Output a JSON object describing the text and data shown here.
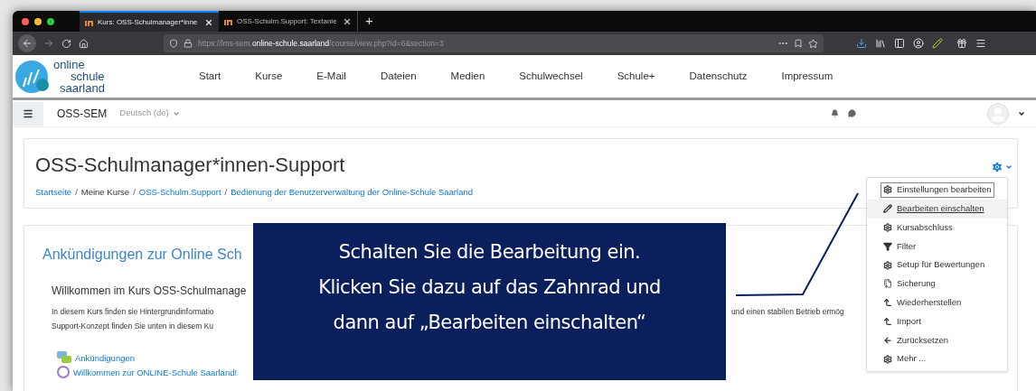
{
  "browser": {
    "tabs": [
      {
        "label": "Kurs: OSS-Schulmanager*inne",
        "selected": true
      },
      {
        "label": "OSS-Schulm.Support: Textanle",
        "selected": false
      }
    ],
    "new_tab": "+",
    "url": {
      "prefix": "https://lms-sem.",
      "domain": "online-schule.saarland",
      "path": "/course/view.php?id=6&section=3"
    }
  },
  "site": {
    "logo_lines": [
      "online",
      "schule",
      "saarland"
    ],
    "nav": [
      "Start",
      "Kurse",
      "E-Mail",
      "Dateien",
      "Medien",
      "Schulwechsel",
      "Schule+",
      "Datenschutz",
      "Impressum"
    ]
  },
  "topbar": {
    "site_name": "OSS-SEM",
    "language": "Deutsch (de)"
  },
  "course": {
    "title": "OSS-Schulmanager*innen-Support",
    "breadcrumb": [
      {
        "label": "Startseite",
        "link": true
      },
      {
        "separator": "/",
        "label": "Meine Kurse",
        "link": false
      },
      {
        "separator": "/",
        "label": "OSS-Schulm.Support",
        "link": true
      },
      {
        "separator": "/",
        "label": "Bedienung der Benutzerverwaltung der Online-Schule Saarland",
        "link": true
      }
    ]
  },
  "section": {
    "heading": "Ankündigungen zur Online Sch",
    "welcome": "Willkommen im Kurs OSS-Schulmanage",
    "paragraph_lines": [
      "In diesem Kurs finden sie Hintergrundinformatio",
      "Support-Konzept finden Sie unten in diesem Ku"
    ],
    "paragraph_right": "und einen stabilen Betrieb ermög",
    "activities": [
      {
        "label": "Ankündigungen",
        "kind": "forum"
      },
      {
        "label": "Willkommen zur ONLINE-Schule Saarland!",
        "kind": "page"
      }
    ]
  },
  "menu": {
    "items": [
      {
        "label": "Einstellungen bearbeiten",
        "kind": "gear",
        "focused": true,
        "hovered": false
      },
      {
        "label": "Bearbeiten einschalten",
        "kind": "pencil",
        "focused": false,
        "hovered": true
      },
      {
        "label": "Kursabschluss",
        "kind": "gear",
        "focused": false,
        "hovered": false
      },
      {
        "label": "Filter",
        "kind": "filter",
        "focused": false,
        "hovered": false
      },
      {
        "label": "Setup für Bewertungen",
        "kind": "gear",
        "focused": false,
        "hovered": false
      },
      {
        "label": "Sicherung",
        "kind": "file",
        "focused": false,
        "hovered": false
      },
      {
        "label": "Wiederherstellen",
        "kind": "levelup",
        "focused": false,
        "hovered": false
      },
      {
        "label": "Import",
        "kind": "levelup",
        "focused": false,
        "hovered": false
      },
      {
        "label": "Zurücksetzen",
        "kind": "back",
        "focused": false,
        "hovered": false
      },
      {
        "label": "Mehr ...",
        "kind": "gear",
        "focused": false,
        "hovered": false
      }
    ]
  },
  "callout": {
    "lines": [
      "Schalten Sie die Bearbeitung ein.",
      "Klicken Sie dazu auf das Zahnrad und",
      "dann auf „Bearbeiten einschalten“"
    ]
  }
}
